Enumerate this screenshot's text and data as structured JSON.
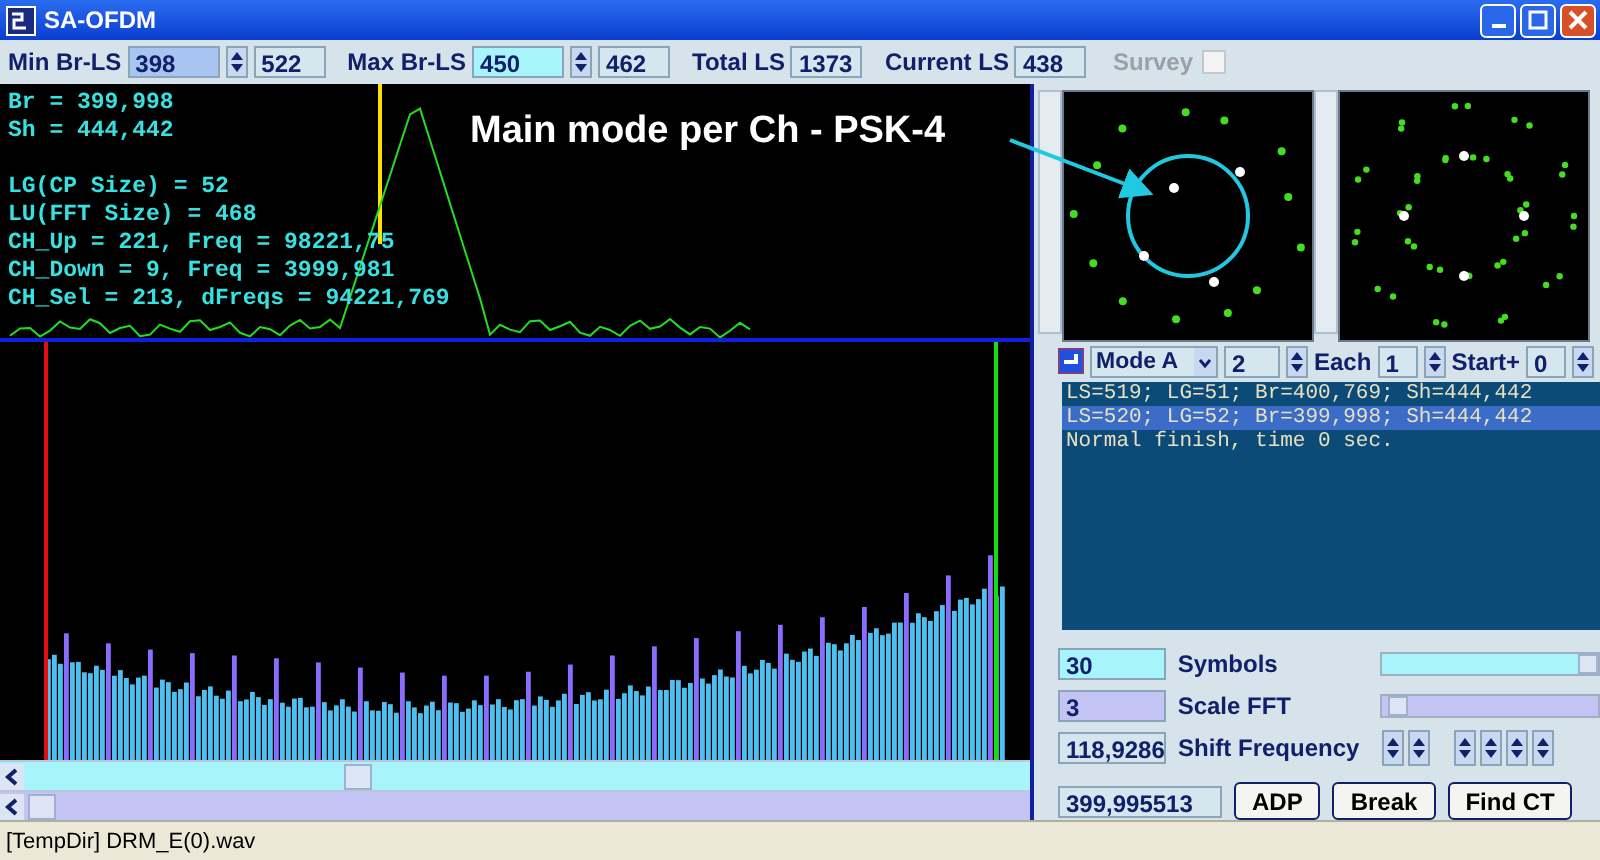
{
  "window": {
    "title": "SA-OFDM"
  },
  "toolbar": {
    "min_br_ls": {
      "label": "Min Br-LS",
      "value": "398",
      "value_2": "522"
    },
    "max_br_ls": {
      "label": "Max Br-LS",
      "value": "450",
      "value_2": "462"
    },
    "total_ls": {
      "label": "Total LS",
      "value": "1373"
    },
    "current_ls": {
      "label": "Current LS",
      "value": "438"
    },
    "survey": {
      "label": "Survey",
      "checked": false,
      "disabled": true
    }
  },
  "plot": {
    "readouts_top": [
      "Br = 399,998",
      "Sh = 444,442"
    ],
    "readouts": [
      "LG(CP Size) = 52",
      "LU(FFT Size) = 468",
      "CH_Up = 221, Freq = 98221,75",
      "CH_Down = 9, Freq = 3999,981",
      "CH_Sel = 213, dFreqs = 94221,769"
    ],
    "annotation": "Main mode per Ch - PSK-4"
  },
  "mode_bar": {
    "mode": "Mode A",
    "value": "2",
    "each_label": "Each",
    "each_value": "1",
    "start_label": "Start+",
    "start_value": "0"
  },
  "log": [
    {
      "text": "LS=519; LG=51; Br=400,769; Sh=444,442",
      "selected": false
    },
    {
      "text": "LS=520; LG=52; Br=399,998; Sh=444,442",
      "selected": true
    },
    {
      "text": "Normal finish, time 0 sec.",
      "selected": false
    }
  ],
  "params": [
    {
      "kind": "slider",
      "value": "30",
      "label": "Symbols",
      "level": 1
    },
    {
      "kind": "slider",
      "value": "3",
      "label": "Scale FFT",
      "level": 0.03
    },
    {
      "kind": "spinners",
      "value": "118,9286",
      "label": "Shift Frequency"
    }
  ],
  "result": "399,995513",
  "buttons": [
    "ADP",
    "Break",
    "Find CT"
  ],
  "status_bar": "[TempDir] DRM_E(0).wav"
}
